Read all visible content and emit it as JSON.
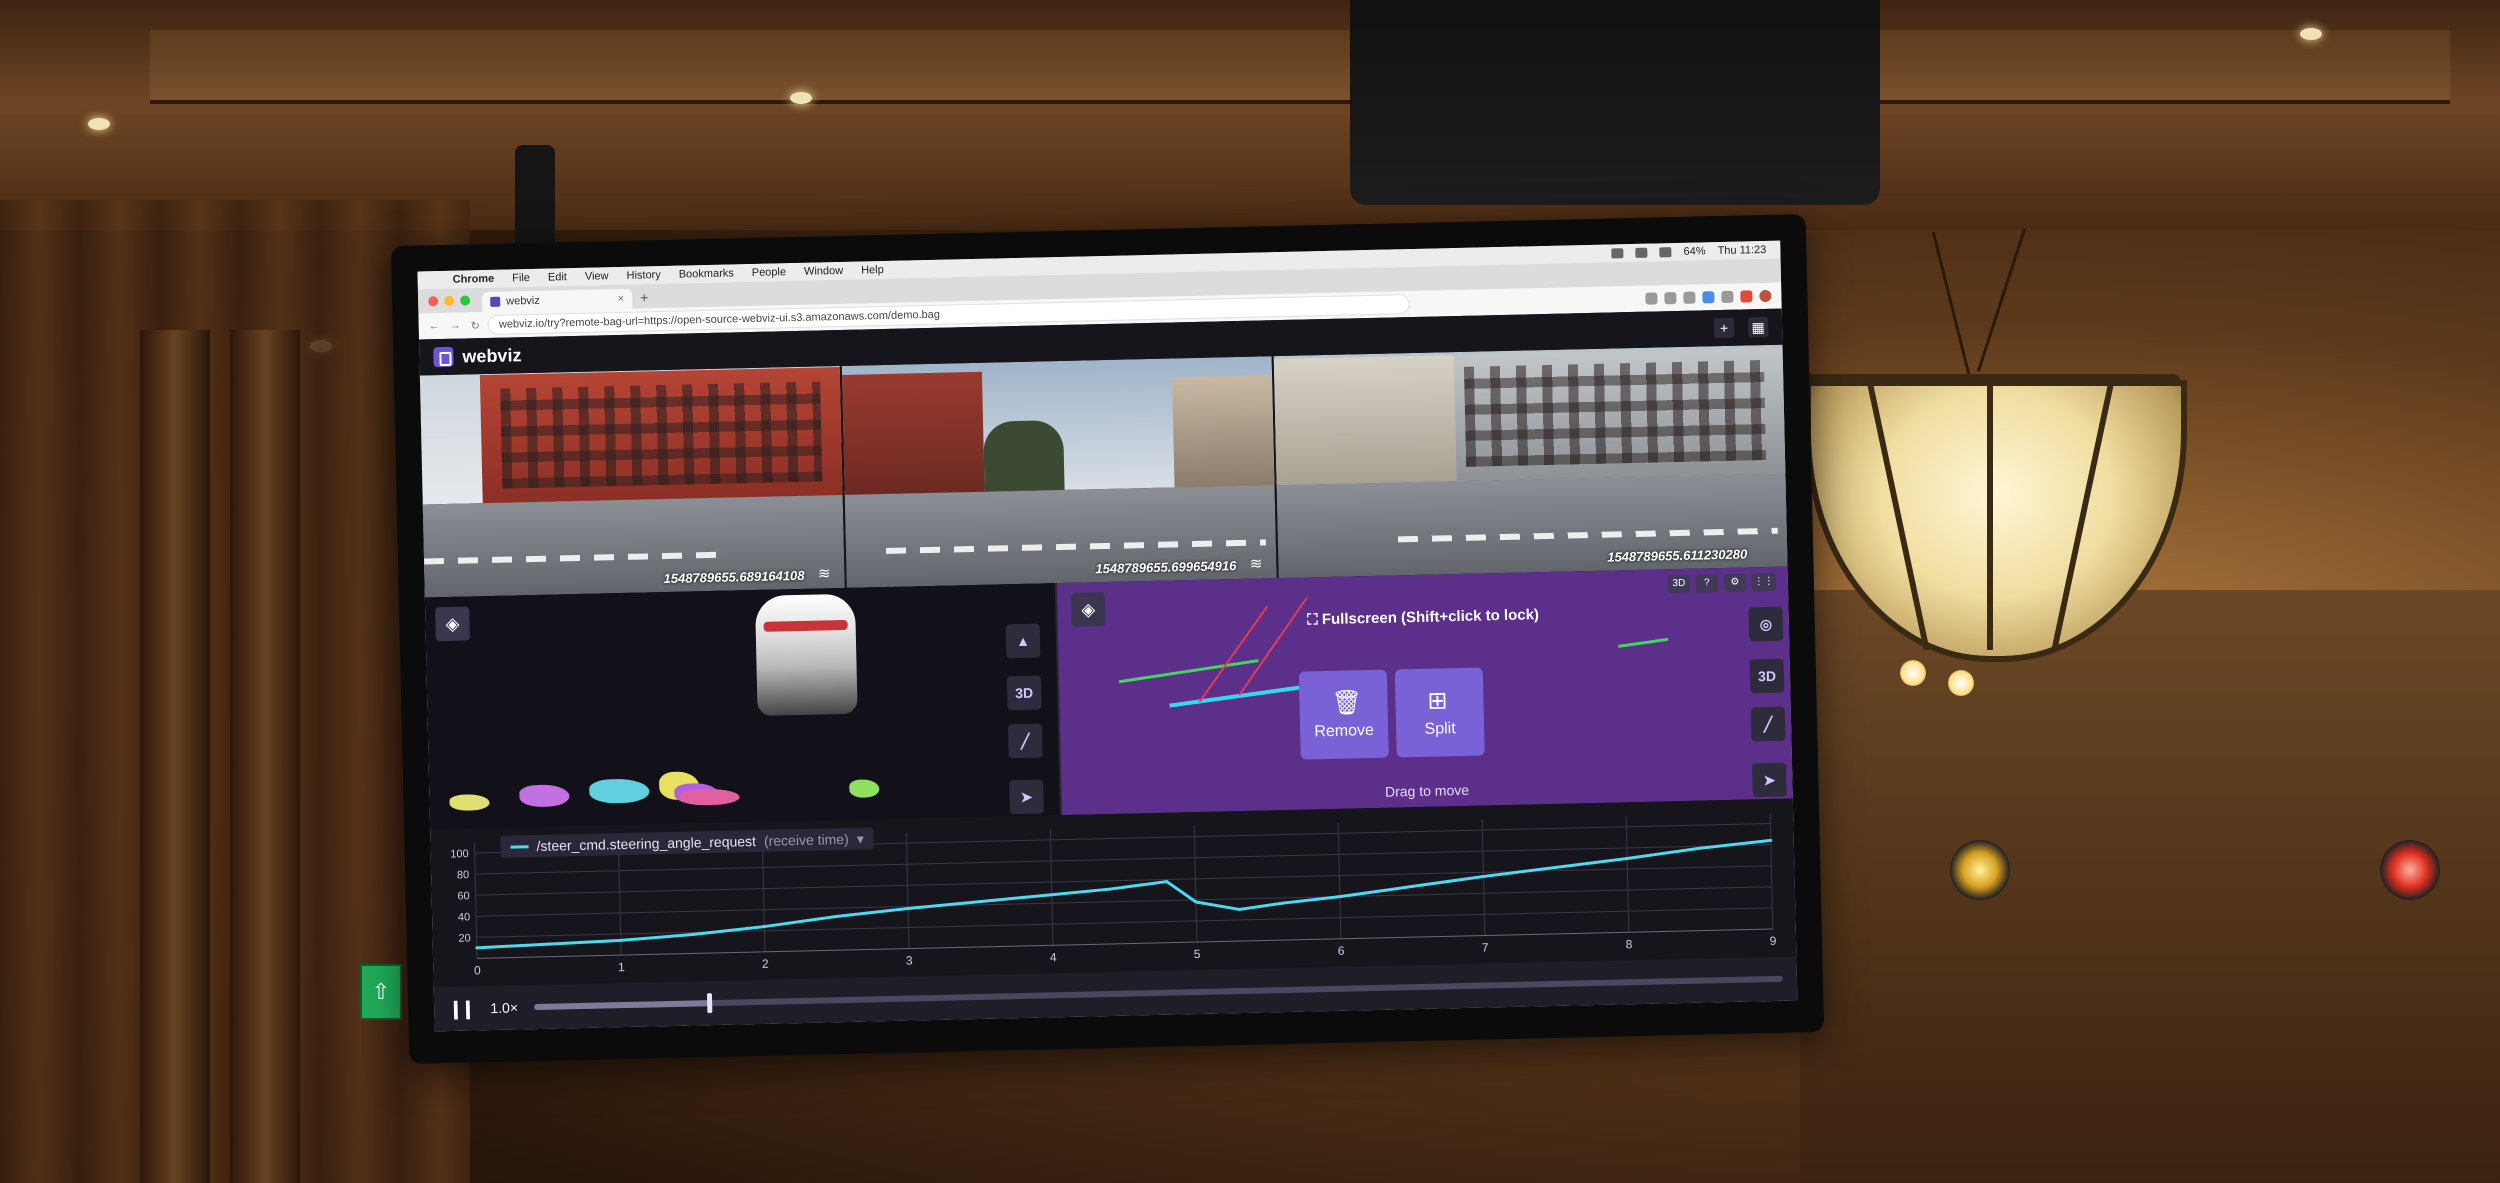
{
  "menubar": {
    "apple": "",
    "items": [
      "Chrome",
      "File",
      "Edit",
      "View",
      "History",
      "Bookmarks",
      "People",
      "Window",
      "Help"
    ],
    "clock": "Thu 11:23",
    "battery": "64%"
  },
  "browser": {
    "tab_title": "webviz",
    "url": "webviz.io/try?remote-bag-url=https://open-source-webviz-ui.s3.amazonaws.com/demo.bag"
  },
  "app": {
    "brand": "webviz"
  },
  "cameras": [
    {
      "timestamp": "1548789655.689164108"
    },
    {
      "timestamp": "1548789655.699654916"
    },
    {
      "timestamp": "1548789655.611230280"
    }
  ],
  "panel3d_left": {
    "toolbar": [
      "▲",
      "3D",
      "╱",
      "➤"
    ]
  },
  "panel3d_right": {
    "top_buttons": [
      "3D",
      "?",
      "⚙",
      "⋮⋮"
    ],
    "overlay_hint": "Fullscreen (Shift+click to lock)",
    "remove_label": "Remove",
    "split_label": "Split",
    "drag_hint": "Drag to move",
    "toolbar": [
      "◎",
      "3D",
      "╱",
      "➤"
    ]
  },
  "plot": {
    "legend_label": "/steer_cmd.steering_angle_request",
    "legend_sub": "(receive time)",
    "legend_caret": "▾"
  },
  "playback": {
    "speed": "1.0×",
    "progress": 0.14
  },
  "colors": {
    "line": "#4fd9f0",
    "accent": "#7a62d6",
    "panel_purple": "#5b2f8a"
  },
  "chart_data": {
    "type": "line",
    "title": "",
    "xlabel": "",
    "ylabel": "",
    "x_ticks": [
      "0",
      "1",
      "2",
      "3",
      "4",
      "5",
      "6",
      "7",
      "8",
      "9"
    ],
    "y_ticks": [
      "100",
      "80",
      "60",
      "40",
      "20"
    ],
    "xlim": [
      0,
      9
    ],
    "ylim": [
      0,
      110
    ],
    "grid": true,
    "series": [
      {
        "name": "/steer_cmd.steering_angle_request",
        "x": [
          0,
          0.5,
          1,
          1.5,
          2,
          2.5,
          3,
          3.5,
          4,
          4.4,
          4.8,
          5.0,
          5.3,
          5.6,
          6,
          6.5,
          7,
          7.5,
          8,
          8.5,
          9
        ],
        "y": [
          10,
          12,
          14,
          18,
          24,
          32,
          38,
          43,
          48,
          52,
          58,
          38,
          30,
          35,
          40,
          48,
          56,
          63,
          70,
          78,
          84
        ]
      }
    ]
  }
}
